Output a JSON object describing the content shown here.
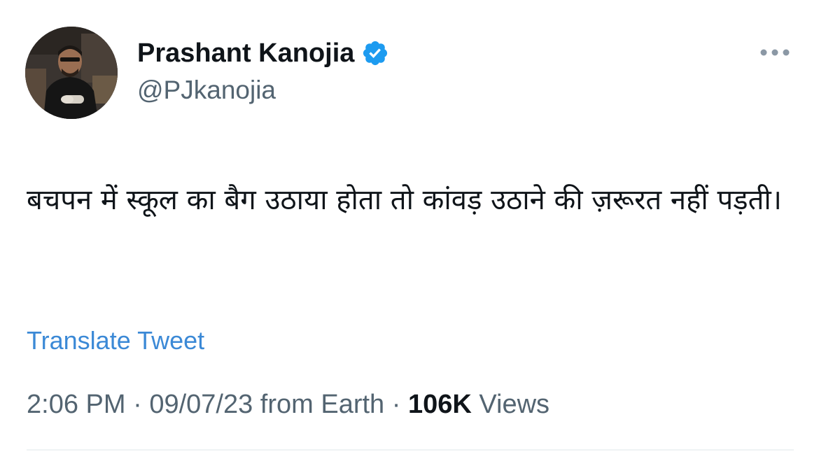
{
  "author": {
    "display_name": "Prashant Kanojia",
    "handle": "@PJkanojia",
    "verified": true
  },
  "icons": {
    "verified": "verified-badge-icon",
    "more": "more-options-icon"
  },
  "tweet": {
    "text": "बचपन में स्कूल का बैग उठाया होता तो कांवड़ उठाने की ज़रूरत नहीं पड़ती।",
    "translate_label": "Translate Tweet",
    "time": "2:06 PM",
    "separator": "·",
    "date": "09/07/23",
    "source": "from Earth",
    "views_count": "106K",
    "views_label": "Views"
  },
  "colors": {
    "verified": "#1d9bf0",
    "link": "#3b89d6",
    "secondary_text": "#536471",
    "primary_text": "#0f1419"
  }
}
